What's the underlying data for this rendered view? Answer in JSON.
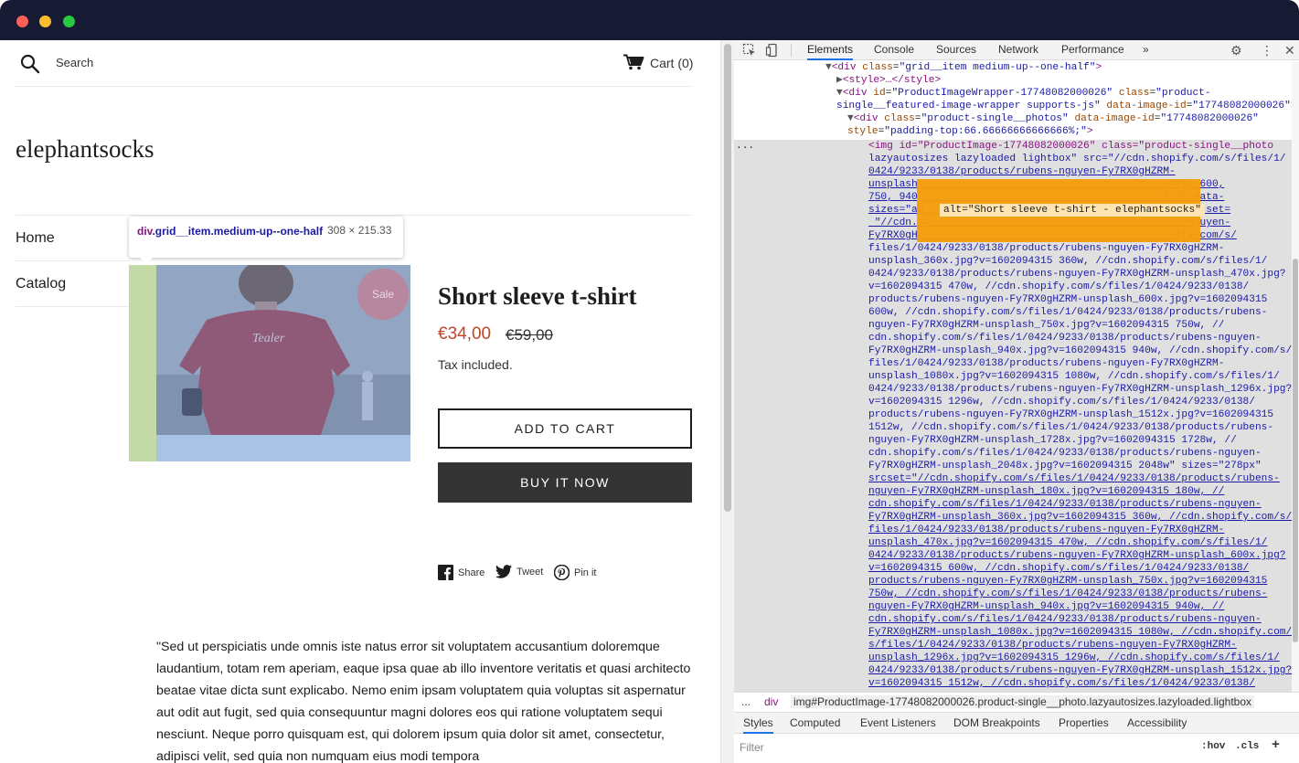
{
  "window": {
    "title_dots": [
      "close",
      "minimize",
      "maximize"
    ]
  },
  "shop": {
    "search_label": "Search",
    "cart_label": "Cart (0)",
    "shop_name": "elephantsocks",
    "nav": [
      {
        "label": "Home"
      },
      {
        "label": "Catalog"
      }
    ],
    "product": {
      "title": "Short sleeve t-shirt",
      "sale_price": "€34,00",
      "compare_price": "€59,00",
      "tax_note": "Tax included.",
      "sale_badge": "Sale",
      "add_to_cart": "ADD TO CART",
      "buy_now": "BUY IT NOW",
      "photo_print": "Tealer"
    },
    "social": {
      "share": "Share",
      "tweet": "Tweet",
      "pin": "Pin it"
    },
    "description": "\"Sed ut perspiciatis unde omnis iste natus error sit voluptatem accusantium doloremque laudantium, totam rem aperiam, eaque ipsa quae ab illo inventore veritatis et quasi architecto beatae vitae dicta sunt explicabo. Nemo enim ipsam voluptatem quia voluptas sit aspernatur aut odit aut fugit, sed quia consequuntur magni dolores eos qui ratione voluptatem sequi nesciunt. Neque porro quisquam est, qui dolorem ipsum quia dolor sit amet, consectetur, adipisci velit, sed quia non numquam eius modi tempora"
  },
  "inspector": {
    "tooltip_tag": "div",
    "tooltip_classes": ".grid__item.medium-up--one-half",
    "tooltip_size": "308 × 215.33"
  },
  "devtools": {
    "tabs": [
      "Elements",
      "Console",
      "Sources",
      "Network",
      "Performance",
      "»"
    ],
    "active_tab": "Elements",
    "alt_highlight": "alt=\"Short sleeve t-shirt - elephantsocks\"",
    "breadcrumb": [
      "...",
      "div",
      "img#ProductImage-17748082000026.product-single__photo.lazyautosizes.lazyloaded.lightbox"
    ],
    "subtabs": [
      "Styles",
      "Computed",
      "Event Listeners",
      "DOM Breakpoints",
      "Properties",
      "Accessibility"
    ],
    "active_subtab": "Styles",
    "filter_placeholder": "Filter",
    "filter_hov": ":hov",
    "filter_cls": ".cls",
    "filter_add": "+",
    "dots": "...",
    "code": {
      "l1_tag_open": "<div ",
      "l1_attr": "class",
      "l1_val": "\"grid__item medium-up--one-half\"",
      "l1_close": ">",
      "l2": "<style>…</style>",
      "l3_tag": "<div ",
      "l3_attr1": "id",
      "l3_val1": "\"ProductImageWrapper-17748082000026\"",
      "l3_attr2": " class",
      "l3_val2a": "\"product-",
      "l4_val2b": "single__featured-image-wrapper supports-js\"",
      "l4_attr3": " data-image-id",
      "l4_val3": "\"17748082000026\"",
      "l5_tag": "<div ",
      "l5_attr1": "class",
      "l5_val1": "\"product-single__photos\"",
      "l5_attr2": " data-image-id",
      "l5_val2": "\"17748082000026\"",
      "l6_attr": "style",
      "l6_val": "\"padding-top:66.66666666666666%;\"",
      "img_lines": [
        "<img id=\"ProductImage-17748082000026\" class=\"product-single__photo",
        "lazyautosizes lazyloaded lightbox\" src=\"//cdn.shopify.com/s/files/1/",
        "0424/9233/0138/products/rubens-nguyen-Fy7RX0gHZRM-",
        "unsplash                                         470, 600,",
        "750, 940                                        1.5\" data-",
        "sizes=\"au                                         a-srcset=",
        " \"//cdn.sh                                         -nguyen-",
        "Fy7RX0gH                                          ify.com/s/",
        "files/1/0424/9233/0138/products/rubens-nguyen-Fy7RX0gHZRM-",
        "unsplash_360x.jpg?v=1602094315 360w, //cdn.shopify.com/s/files/1/",
        "0424/9233/0138/products/rubens-nguyen-Fy7RX0gHZRM-unsplash_470x.jpg?",
        "v=1602094315 470w, //cdn.shopify.com/s/files/1/0424/9233/0138/",
        "products/rubens-nguyen-Fy7RX0gHZRM-unsplash_600x.jpg?v=1602094315",
        "600w, //cdn.shopify.com/s/files/1/0424/9233/0138/products/rubens-",
        "nguyen-Fy7RX0gHZRM-unsplash_750x.jpg?v=1602094315 750w, //",
        "cdn.shopify.com/s/files/1/0424/9233/0138/products/rubens-nguyen-",
        "Fy7RX0gHZRM-unsplash_940x.jpg?v=1602094315 940w, //cdn.shopify.com/s/",
        "files/1/0424/9233/0138/products/rubens-nguyen-Fy7RX0gHZRM-",
        "unsplash_1080x.jpg?v=1602094315 1080w, //cdn.shopify.com/s/files/1/",
        "0424/9233/0138/products/rubens-nguyen-Fy7RX0gHZRM-unsplash_1296x.jpg?",
        "v=1602094315 1296w, //cdn.shopify.com/s/files/1/0424/9233/0138/",
        "products/rubens-nguyen-Fy7RX0gHZRM-unsplash_1512x.jpg?v=1602094315",
        "1512w, //cdn.shopify.com/s/files/1/0424/9233/0138/products/rubens-",
        "nguyen-Fy7RX0gHZRM-unsplash_1728x.jpg?v=1602094315 1728w, //",
        "cdn.shopify.com/s/files/1/0424/9233/0138/products/rubens-nguyen-",
        "Fy7RX0gHZRM-unsplash_2048x.jpg?v=1602094315 2048w\" sizes=\"278px\"",
        "srcset=\"//cdn.shopify.com/s/files/1/0424/9233/0138/products/rubens-",
        "nguyen-Fy7RX0gHZRM-unsplash_180x.jpg?v=1602094315 180w, //",
        "cdn.shopify.com/s/files/1/0424/9233/0138/products/rubens-nguyen-",
        "Fy7RX0gHZRM-unsplash_360x.jpg?v=1602094315 360w, //cdn.shopify.com/s/",
        "files/1/0424/9233/0138/products/rubens-nguyen-Fy7RX0gHZRM-",
        "unsplash_470x.jpg?v=1602094315 470w, //cdn.shopify.com/s/files/1/",
        "0424/9233/0138/products/rubens-nguyen-Fy7RX0gHZRM-unsplash_600x.jpg?",
        "v=1602094315 600w, //cdn.shopify.com/s/files/1/0424/9233/0138/",
        "products/rubens-nguyen-Fy7RX0gHZRM-unsplash_750x.jpg?v=1602094315",
        "750w, //cdn.shopify.com/s/files/1/0424/9233/0138/products/rubens-",
        "nguyen-Fy7RX0gHZRM-unsplash_940x.jpg?v=1602094315 940w, //",
        "cdn.shopify.com/s/files/1/0424/9233/0138/products/rubens-nguyen-",
        "Fy7RX0gHZRM-unsplash_1080x.jpg?v=1602094315 1080w, //cdn.shopify.com/",
        "s/files/1/0424/9233/0138/products/rubens-nguyen-Fy7RX0gHZRM-",
        "unsplash_1296x.jpg?v=1602094315 1296w, //cdn.shopify.com/s/files/1/",
        "0424/9233/0138/products/rubens-nguyen-Fy7RX0gHZRM-unsplash_1512x.jpg?",
        "v=1602094315 1512w, //cdn.shopify.com/s/files/1/0424/9233/0138/"
      ]
    }
  },
  "colors": {
    "titlebar": "#161a33",
    "sale_price": "#c0452b",
    "highlight_content": "#a9c3e4",
    "highlight_padding": "#c3d9a6",
    "alt_highlight": "#f59e0b"
  }
}
